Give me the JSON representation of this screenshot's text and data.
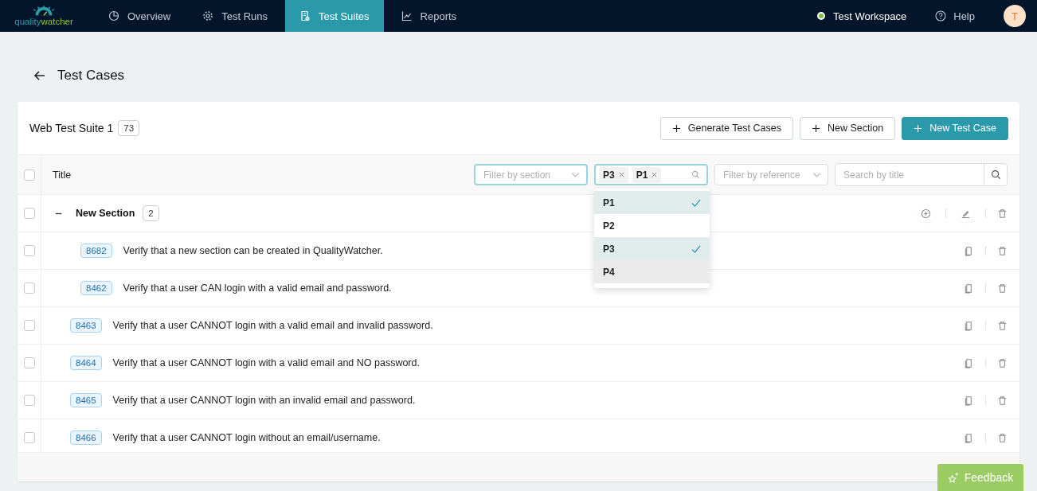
{
  "logo": {
    "part_1": "quality",
    "part_2": "watcher"
  },
  "nav": [
    {
      "label": "Overview",
      "selected": false
    },
    {
      "label": "Test Runs",
      "selected": false
    },
    {
      "label": "Test Suites",
      "selected": true
    },
    {
      "label": "Reports",
      "selected": false
    }
  ],
  "workspace": {
    "label": "Test Workspace",
    "color": "#7bc043"
  },
  "help": "Help",
  "avatar": "T",
  "page_title": "Test Cases",
  "suite": {
    "name": "Web Test Suite 1",
    "count": "73"
  },
  "actions": [
    {
      "label": "Generate Test Cases",
      "primary": false
    },
    {
      "label": "New Section",
      "primary": false
    },
    {
      "label": "New Test Case",
      "primary": true
    }
  ],
  "table": {
    "title_column": "Title",
    "all_checked": false,
    "section_filter": {
      "placeholder": "Filter by section"
    },
    "priority_filter": {
      "chips": [
        "P3",
        "P1"
      ],
      "options": [
        {
          "label": "P1",
          "selected": true,
          "hovered": false
        },
        {
          "label": "P2",
          "selected": false,
          "hovered": false
        },
        {
          "label": "P3",
          "selected": true,
          "hovered": false
        },
        {
          "label": "P4",
          "selected": false,
          "hovered": true
        }
      ]
    },
    "reference_filter": {
      "placeholder": "Filter by reference"
    },
    "search": {
      "placeholder": "Search by title"
    },
    "rows": [
      {
        "kind": "section",
        "name": "New Section",
        "count": "2",
        "expanded": true,
        "checked": false,
        "children": [
          {
            "kind": "case",
            "id": "8682",
            "title": "Verify that a new section can be created in QualityWatcher.",
            "checked": false
          },
          {
            "kind": "case",
            "id": "8462",
            "title": "Verify that a user CAN login with a valid email and password.",
            "checked": false
          }
        ]
      },
      {
        "kind": "case",
        "id": "8463",
        "title": "Verify that a user CANNOT login with a valid email and invalid password.",
        "checked": false
      },
      {
        "kind": "case",
        "id": "8464",
        "title": "Verify that a user CANNOT login with a valid email and NO password.",
        "checked": false
      },
      {
        "kind": "case",
        "id": "8465",
        "title": "Verify that a user CANNOT login with an invalid email and password.",
        "checked": false
      },
      {
        "kind": "case",
        "id": "8466",
        "title": "Verify that a user CANNOT login without an email/username.",
        "checked": false
      }
    ]
  },
  "feedback": "Feedback"
}
